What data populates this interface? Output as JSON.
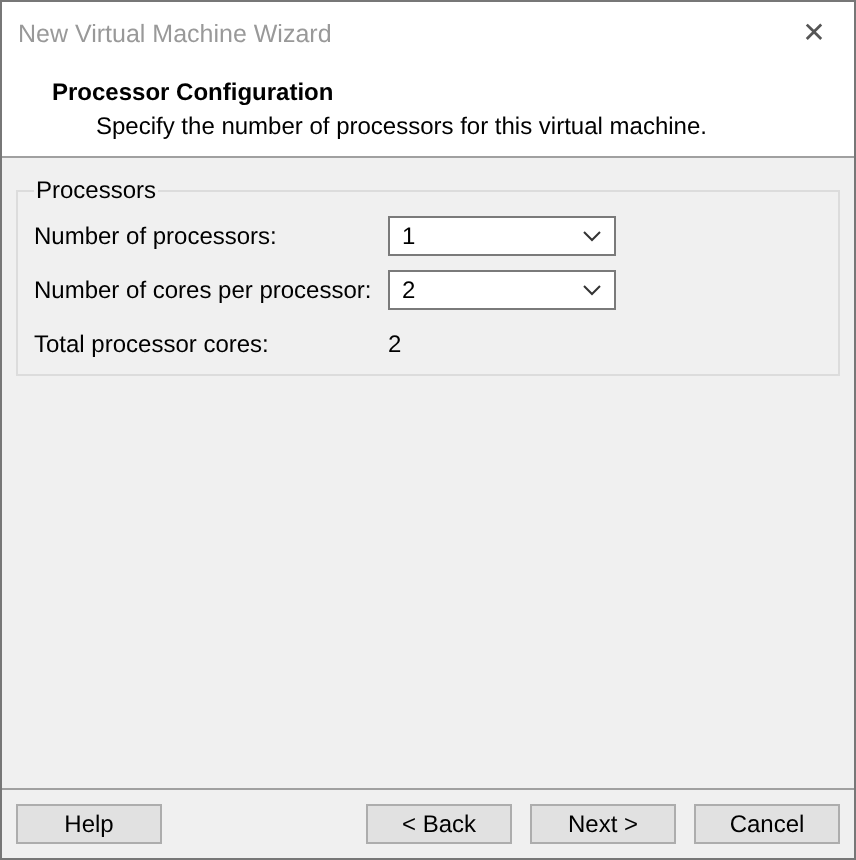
{
  "window": {
    "title": "New Virtual Machine Wizard",
    "close": "✕"
  },
  "header": {
    "title": "Processor Configuration",
    "subtitle": "Specify the number of processors for this virtual machine."
  },
  "group": {
    "legend": "Processors",
    "fields": [
      {
        "kind": "select",
        "label": "Number of processors:",
        "value": "1"
      },
      {
        "kind": "select",
        "label": "Number of cores per processor:",
        "value": "2"
      },
      {
        "kind": "readout",
        "label": "Total processor cores:",
        "value": "2"
      }
    ]
  },
  "buttons": {
    "left": [
      "Help"
    ],
    "right": [
      "< Back",
      "Next >",
      "Cancel"
    ]
  }
}
